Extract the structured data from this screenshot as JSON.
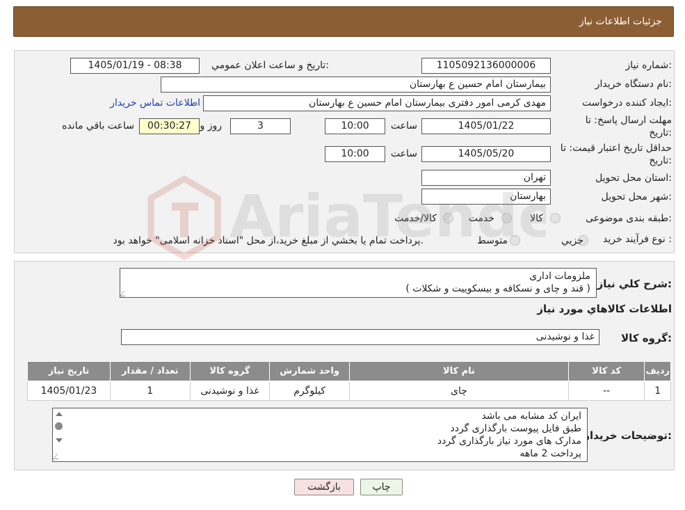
{
  "header": {
    "title": "جزئیات اطلاعات نیاز"
  },
  "form": {
    "need_number_label": "شماره نیاز:",
    "need_number": "1105092136000006",
    "announce_label": "تاریخ و ساعت اعلان عمومي:",
    "announce_value": "1405/01/19 - 08:38",
    "buyer_org_label": "نام دستگاه خريدار:",
    "buyer_org": "بیمارستان امام حسین  ع  بهارستان",
    "requester_label": "ايجاد كننده درخواست:",
    "requester": "مهدی کرمی امور دفتری بیمارستان امام حسین  ع  بهارستان",
    "contact_link": "اطلاعات تماس خريدار",
    "reply_deadline_label_1": "مهلت ارسال پاسخ: تا",
    "reply_deadline_label_2": "تاريخ:",
    "reply_date": "1405/01/22",
    "time_label": "ساعت",
    "reply_time": "10:00",
    "days_value": "3",
    "days_label": "روز و",
    "remaining_value": "00:30:27",
    "remaining_label": "ساعت باقي مانده",
    "validity_label_1": "حداقل تاريخ اعتبار قيمت: تا",
    "validity_label_2": "تاريخ:",
    "validity_date": "1405/05/20",
    "validity_time": "10:00",
    "province_label": "استان محل تحويل:",
    "province": "تهران",
    "city_label": "شهر محل تحويل:",
    "city": "بهارستان",
    "category_label": "طبقه بندی موضوعی:",
    "category_options": [
      "كالا",
      "خدمت",
      "كالا/خدمت"
    ],
    "process_label": "نوع فرآيند خريد :",
    "process_options": [
      "جزيي",
      "متوسط"
    ],
    "process_note": "پرداخت تمام يا بخشي از مبلغ خريد،از محل \"اسناد خزانه اسلامی\" خواهد بود."
  },
  "details": {
    "summary_label": "شرح كلي نياز:",
    "summary_lines": [
      "ملزومات اداری",
      "( قند و چای و نسکافه و بیسکوییت و شکلات )"
    ],
    "items_title": "اطلاعات كالاهاي مورد نياز",
    "group_label": "گروه كالا:",
    "group_value": "غذا و نوشیدنی",
    "table": {
      "headers": [
        "رديف",
        "كد كالا",
        "نام كالا",
        "واحد شمارش",
        "گروه كالا",
        "تعداد / مقدار",
        "تاريخ نياز"
      ],
      "rows": [
        [
          "1",
          "--",
          "چای",
          "کیلوگرم",
          "غذا و نوشیدنی",
          "1",
          "1405/01/23"
        ]
      ]
    },
    "buyer_notes_label": "توضيحات خريدار:",
    "buyer_notes_lines": [
      "ایران کد مشابه می باشد",
      "طبق فایل پیوست بارگذاری گردد",
      "مدارک های مورد نیاز بارگذاری گردد",
      "پرداخت 2 ماهه"
    ]
  },
  "buttons": {
    "print": "چاپ",
    "back": "بازگشت"
  },
  "watermark": {
    "text": "AriaTender.neT"
  },
  "colors": {
    "header": "#8b5e34",
    "print_bg": "#eaf7e6",
    "back_bg": "#f9e1e1"
  }
}
